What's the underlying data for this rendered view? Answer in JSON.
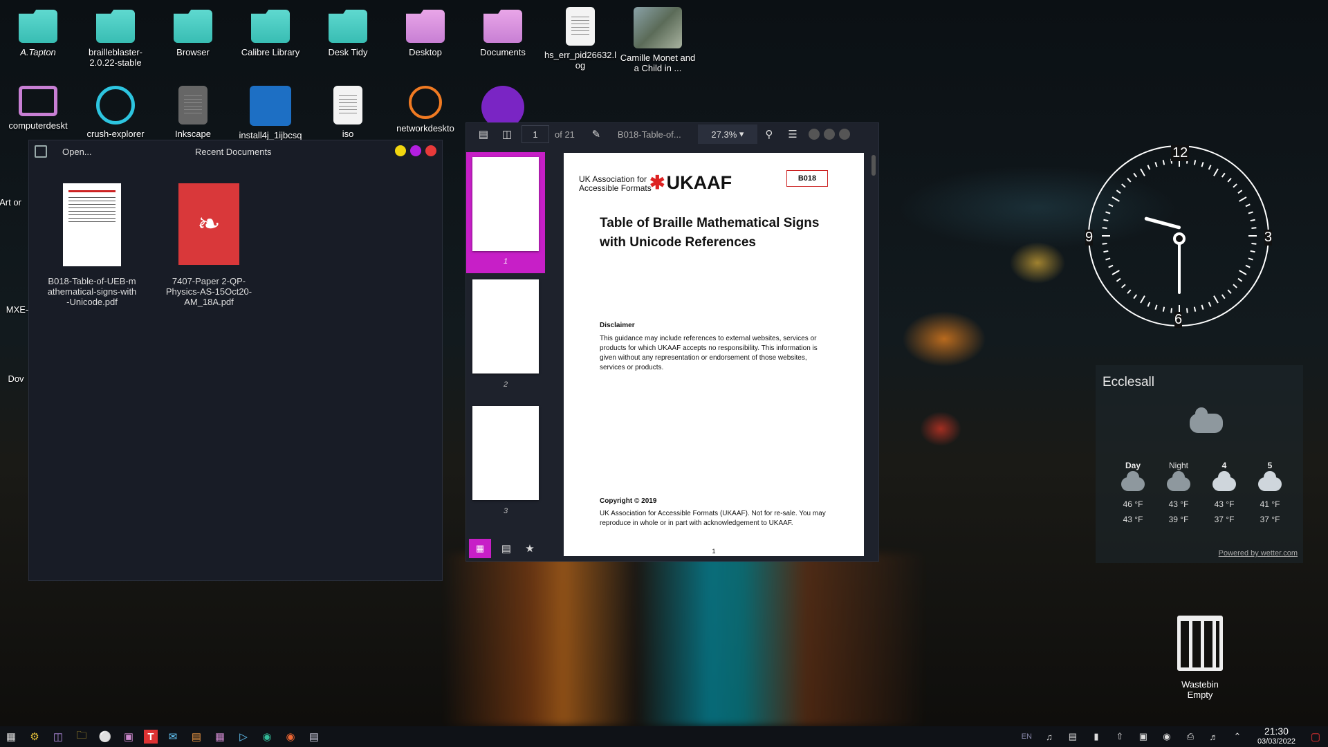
{
  "desktop_icons": [
    {
      "label": "A.Tapton",
      "icon": "folder-icon"
    },
    {
      "label": "brailleblaster-2.0.22-stable",
      "icon": "folder-icon"
    },
    {
      "label": "Browser",
      "icon": "folder-icon"
    },
    {
      "label": "Calibre Library",
      "icon": "folder-icon"
    },
    {
      "label": "Desk Tidy",
      "icon": "folder-icon"
    },
    {
      "label": "Desktop",
      "icon": "folder-icon"
    },
    {
      "label": "Documents",
      "icon": "folder-icon"
    },
    {
      "label": "hs_err_pid26632.log",
      "icon": "text-file-icon"
    },
    {
      "label": "Camille Monet and a Child in ...",
      "icon": "image-file-icon"
    },
    {
      "label": "computerdeskt",
      "icon": "monitor-icon"
    },
    {
      "label": "crush-explorer",
      "icon": "crush-icon"
    },
    {
      "label": "Inkscape",
      "icon": "file-icon"
    },
    {
      "label": "install4j_1ijbcsq",
      "icon": "pdf-app-icon"
    },
    {
      "label": "iso",
      "icon": "text-file-icon"
    },
    {
      "label": "networkdeskto",
      "icon": "network-icon"
    },
    {
      "label": "Art or",
      "icon": "folder-icon"
    },
    {
      "label": "MXE-",
      "icon": "file-icon"
    },
    {
      "label": "Dov",
      "icon": "folder-icon"
    }
  ],
  "recent_window": {
    "open_label": "Open...",
    "title": "Recent Documents",
    "files": [
      {
        "name": "B018-Table-of-UEB-mathematical-signs-with-Unicode.pdf"
      },
      {
        "name": "7407-Paper 2-QP-Physics-AS-15Oct20-AM_18A.pdf"
      }
    ]
  },
  "pdf_viewer": {
    "page_current": "1",
    "page_total": "of 21",
    "doc_title": "B018-Table-of...",
    "zoom": "27.3%",
    "thumb_pages": [
      "1",
      "2",
      "3"
    ],
    "page": {
      "org_name": "UK Association for Accessible Formats",
      "logo": "UKAAF",
      "code": "B018",
      "title": "Table of Braille Mathematical Signs with Unicode References",
      "disclaimer_heading": "Disclaimer",
      "disclaimer_text": "This guidance may include references to external websites, services or products for which UKAAF accepts no responsibility. This information is given without any representation or endorsement of those websites, services or products.",
      "copyright_heading": "Copyright © 2019",
      "copyright_text": "UK Association for Accessible Formats (UKAAF). Not for re-sale. You may reproduce in whole or in part with acknowledgement to UKAAF.",
      "page_number": "1"
    }
  },
  "clock": {
    "numbers": [
      "12",
      "3",
      "6",
      "9"
    ]
  },
  "weather": {
    "location": "Ecclesall",
    "days": [
      {
        "label": "Day",
        "high": "46 °F",
        "low": "43 °F"
      },
      {
        "label": "Night",
        "high": "43 °F",
        "low": "39 °F"
      },
      {
        "label": "4",
        "high": "43 °F",
        "low": "37 °F"
      },
      {
        "label": "5",
        "high": "41 °F",
        "low": "37 °F"
      }
    ],
    "powered": "Powered by wetter.com"
  },
  "wastebin": {
    "label": "Wastebin",
    "state": "Empty"
  },
  "taskbar": {
    "lang": "EN",
    "time": "21:30",
    "date": "03/03/2022"
  }
}
